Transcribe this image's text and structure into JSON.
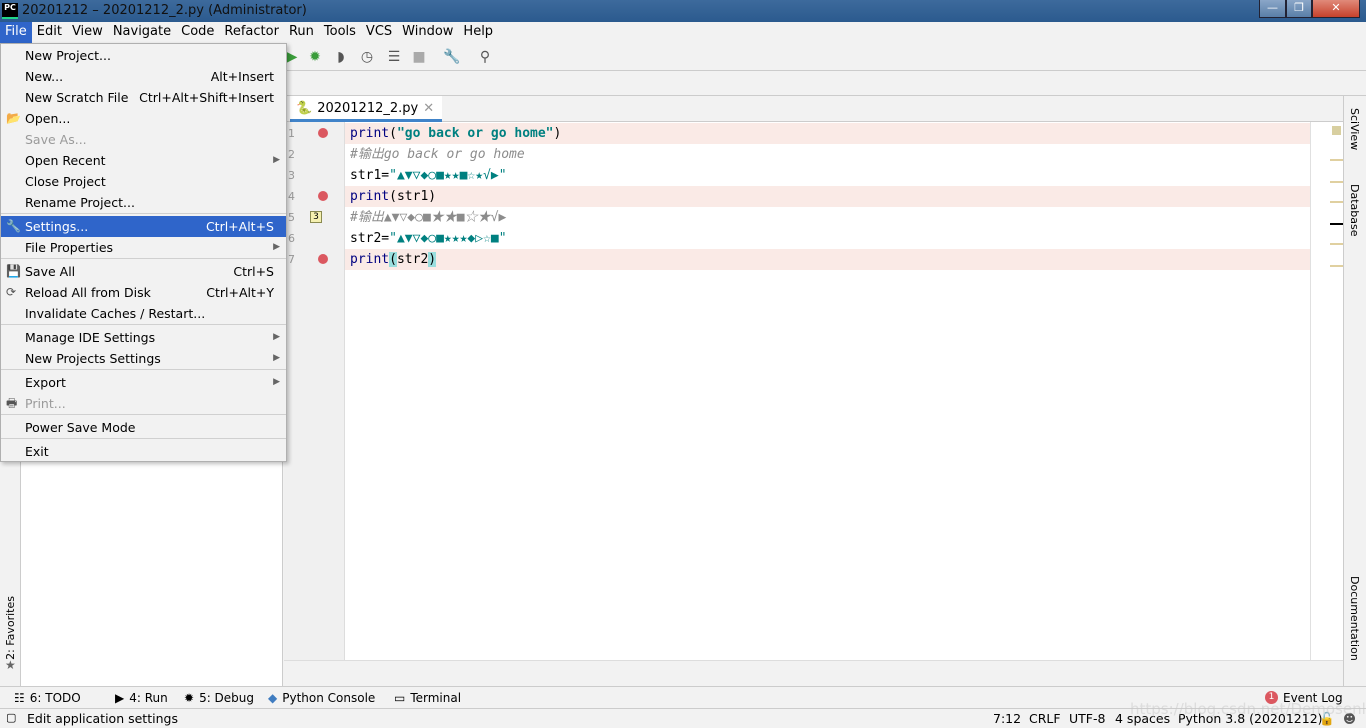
{
  "window": {
    "title": "20201212 – 20201212_2.py (Administrator)",
    "logo": "PC"
  },
  "menubar": [
    "File",
    "Edit",
    "View",
    "Navigate",
    "Code",
    "Refactor",
    "Run",
    "Tools",
    "VCS",
    "Window",
    "Help"
  ],
  "file_menu": [
    {
      "label": "New Project..."
    },
    {
      "label": "New...",
      "shortcut": "Alt+Insert"
    },
    {
      "label": "New Scratch File",
      "shortcut": "Ctrl+Alt+Shift+Insert"
    },
    {
      "label": "Open...",
      "icon": "folder-icon"
    },
    {
      "label": "Save As...",
      "disabled": true
    },
    {
      "label": "Open Recent",
      "submenu": true
    },
    {
      "label": "Close Project"
    },
    {
      "label": "Rename Project..."
    },
    {
      "label": "Settings...",
      "shortcut": "Ctrl+Alt+S",
      "selected": true,
      "icon": "wrench-icon"
    },
    {
      "label": "File Properties",
      "submenu": true
    },
    {
      "label": "Save All",
      "shortcut": "Ctrl+S",
      "icon": "save-icon"
    },
    {
      "label": "Reload All from Disk",
      "shortcut": "Ctrl+Alt+Y",
      "icon": "reload-icon"
    },
    {
      "label": "Invalidate Caches / Restart..."
    },
    {
      "label": "Manage IDE Settings",
      "submenu": true
    },
    {
      "label": "New Projects Settings",
      "submenu": true
    },
    {
      "label": "Export",
      "submenu": true
    },
    {
      "label": "Print...",
      "disabled": true,
      "icon": "print-icon"
    },
    {
      "label": "Power Save Mode"
    },
    {
      "label": "Exit"
    }
  ],
  "editor": {
    "tab": "20201212_2.py",
    "lines": [
      {
        "n": "1",
        "breakpoint": true,
        "parts": [
          [
            "kw",
            "print"
          ],
          [
            "",
            "("
          ],
          [
            "str",
            "\"go back or go home\""
          ],
          [
            "",
            ")"
          ]
        ]
      },
      {
        "n": "2",
        "parts": [
          [
            "cm",
            "#输出go back or go home"
          ]
        ]
      },
      {
        "n": "3",
        "parts": [
          [
            "",
            "str1="
          ],
          [
            "sym",
            "\"▲▼▽◆○■★★■☆★√▶\""
          ]
        ]
      },
      {
        "n": "4",
        "breakpoint": true,
        "parts": [
          [
            "kw",
            "print"
          ],
          [
            "",
            "(str1)"
          ]
        ]
      },
      {
        "n": "5",
        "marker": "3",
        "parts": [
          [
            "cm",
            "#输出▲▼▽◆○■★★■☆★√▶"
          ]
        ]
      },
      {
        "n": "6",
        "parts": [
          [
            "",
            "str2="
          ],
          [
            "sym",
            "\"▲▼▽◆○■★★★◆▷☆■\""
          ]
        ]
      },
      {
        "n": "7",
        "breakpoint": true,
        "parts": [
          [
            "kw",
            "print"
          ],
          [
            "hl",
            "("
          ],
          [
            "",
            "str2"
          ],
          [
            "hl",
            ")"
          ]
        ]
      }
    ]
  },
  "right_tools": [
    "SciView",
    "Database",
    "Documentation"
  ],
  "left_tools": [
    "2: Favorites"
  ],
  "bottom_tools": [
    "6: TODO",
    "4: Run",
    "5: Debug",
    "Python Console",
    "Terminal"
  ],
  "event_log": {
    "label": "Event Log",
    "count": "1"
  },
  "status": {
    "message": "Edit application settings",
    "position": "7:12",
    "line_sep": "CRLF",
    "encoding": "UTF-8",
    "indent": "4 spaces",
    "interpreter": "Python 3.8 (20201212)"
  },
  "watermark": "https://blog.csdn.net/Demosenli",
  "colors": {
    "accent": "#2f65ca",
    "breakpoint": "#db5860",
    "string": "#008080"
  }
}
